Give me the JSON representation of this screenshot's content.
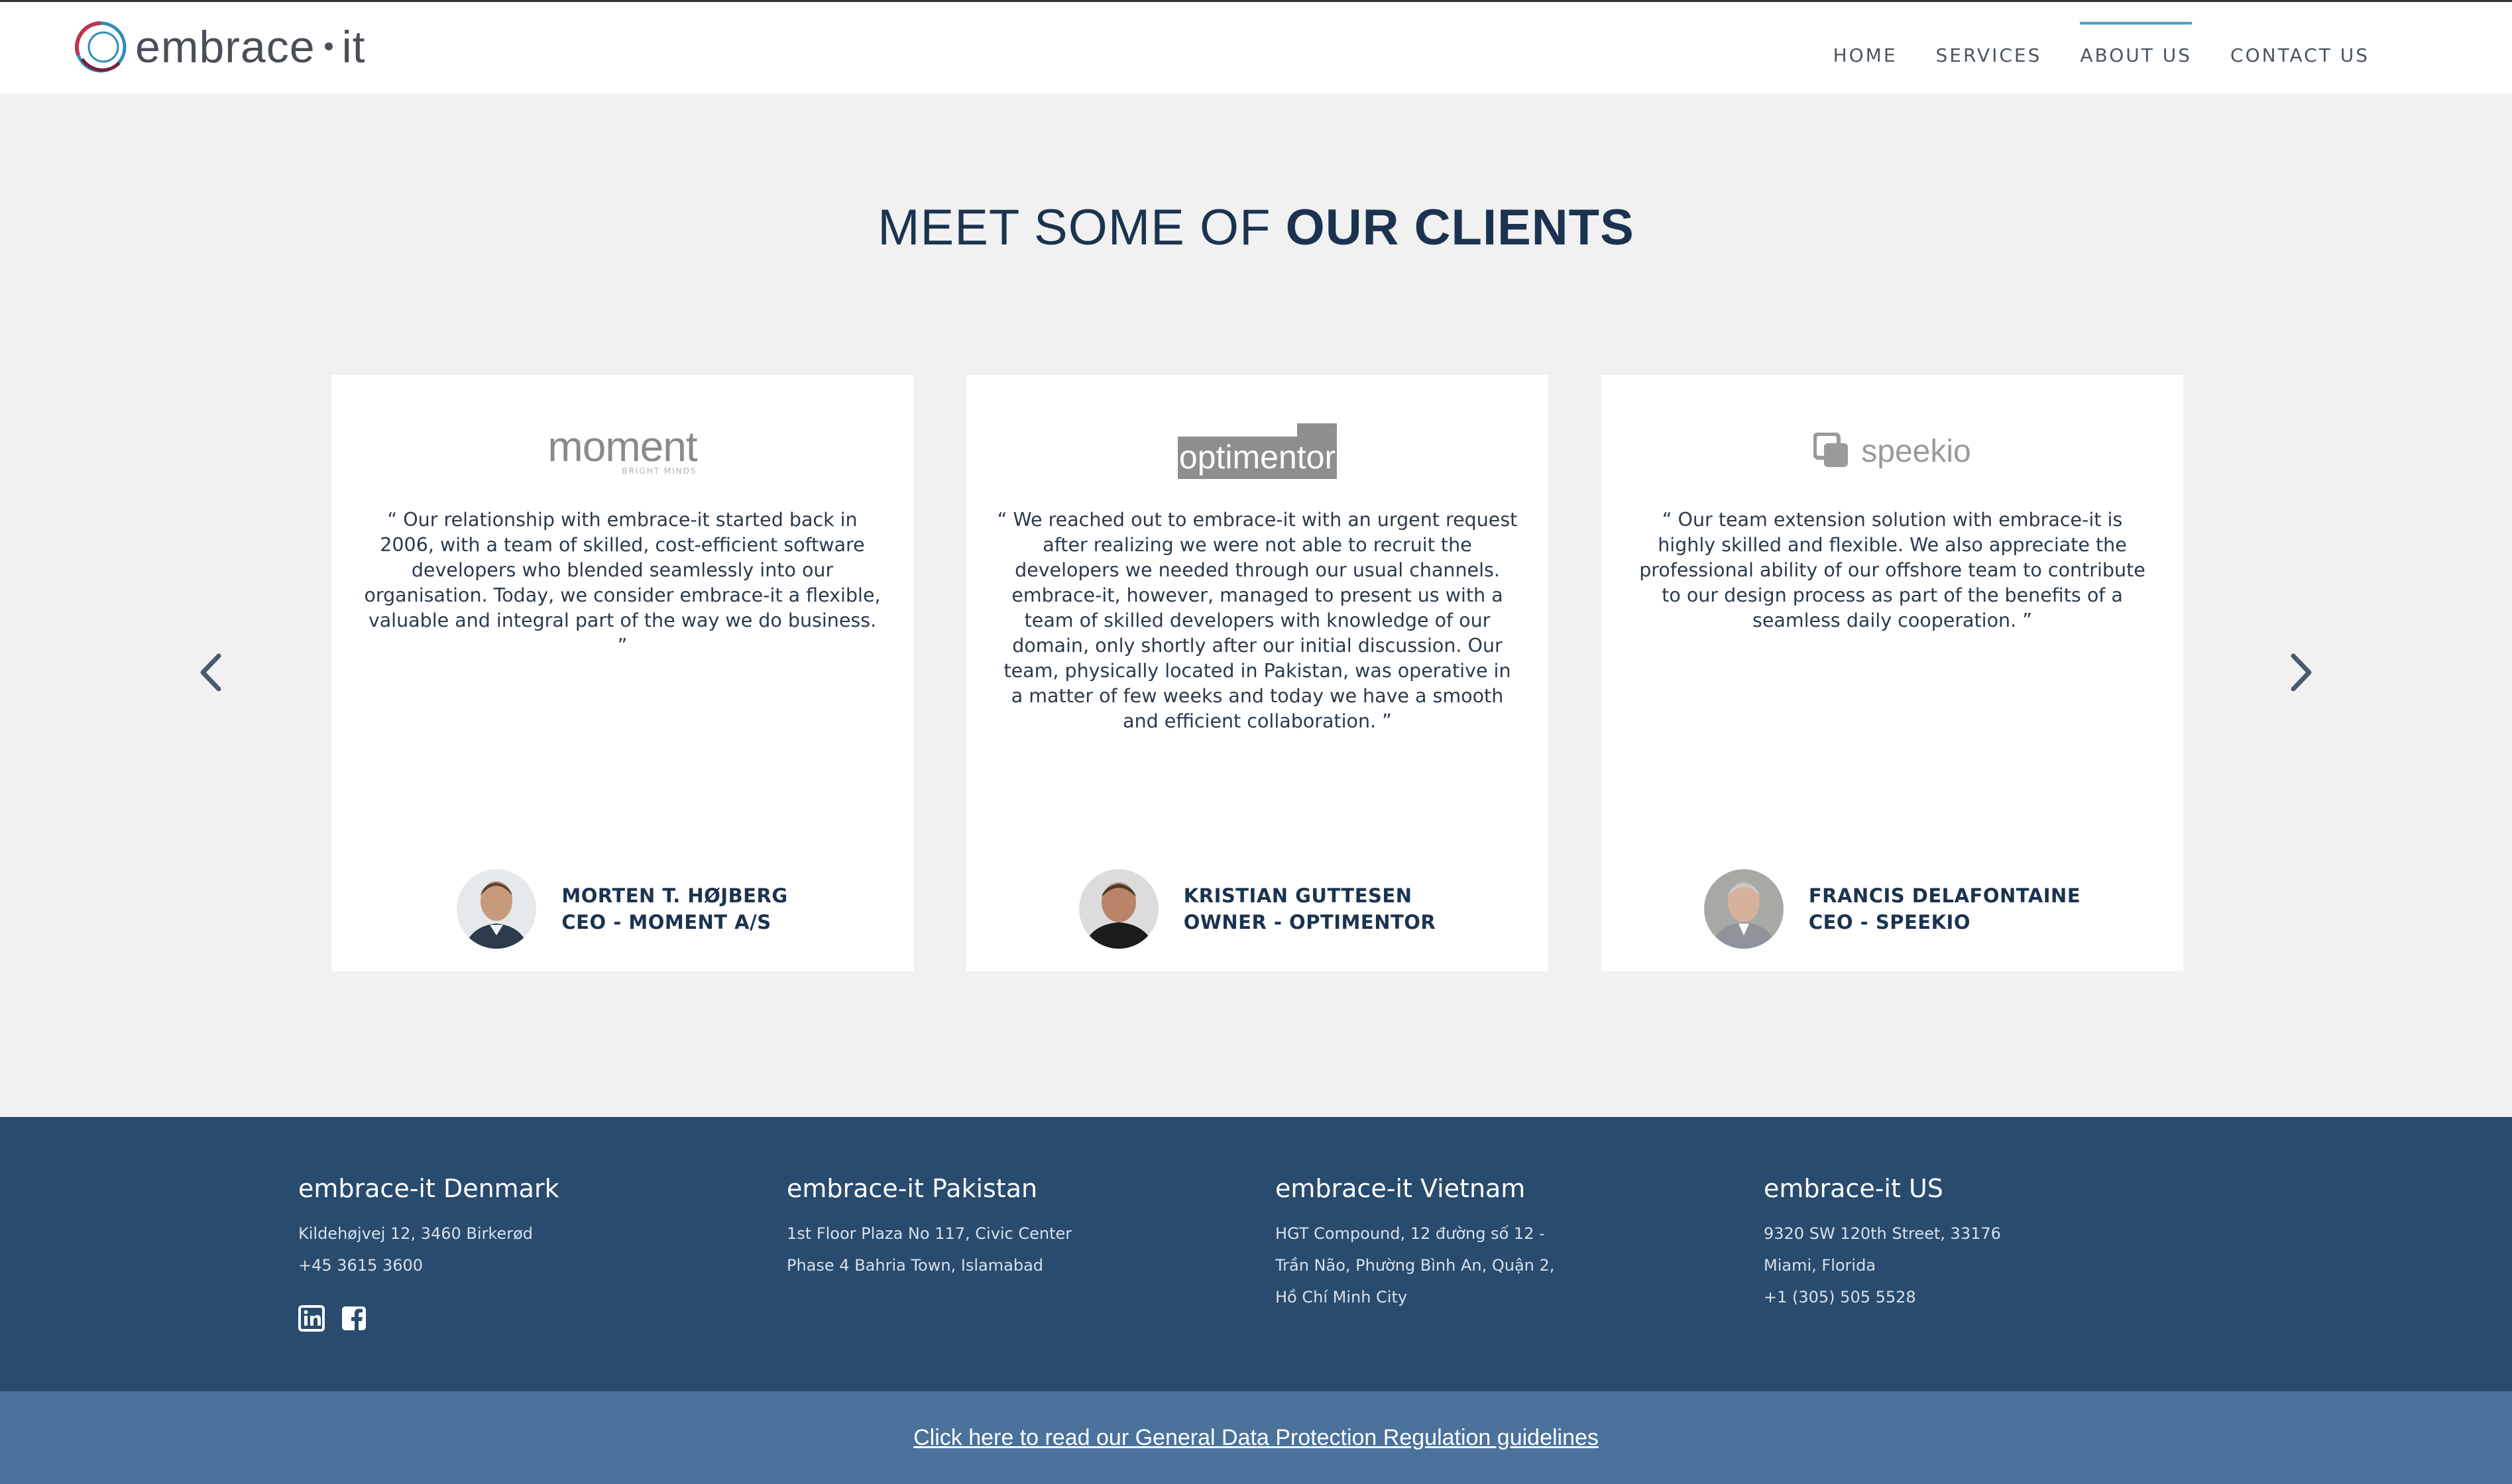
{
  "header": {
    "logo_text_left": "embrace",
    "logo_text_right": "it",
    "nav": [
      {
        "label": "HOME",
        "active": false
      },
      {
        "label": "SERVICES",
        "active": false
      },
      {
        "label": "ABOUT US",
        "active": true
      },
      {
        "label": "CONTACT US",
        "active": false
      }
    ]
  },
  "clients": {
    "title_light": "MEET SOME OF",
    "title_bold": "OUR CLIENTS",
    "prev_icon": "chevron-left-icon",
    "next_icon": "chevron-right-icon",
    "cards": [
      {
        "logo_text": "moment",
        "logo_subtext": "BRIGHT MINDS",
        "quote": "“ Our relationship with embrace-it started back in 2006, with a team of skilled, cost-efficient software developers who blended seamlessly into our organisation. Today, we consider embrace-it a flexible, valuable and integral part of the way we do business. ”",
        "name": "MORTEN T. HØJBERG",
        "role": "CEO - MOMENT A/S"
      },
      {
        "logo_text": "optimentor",
        "quote": "“ We reached out to embrace-it with an urgent request after realizing we were not able to recruit the developers we needed through our usual channels. embrace-it, however, managed to present us with a team of skilled developers with knowledge of our domain, only shortly after our initial discussion. Our team, physically located in Pakistan, was operative in a matter of few weeks and today we have a smooth and efficient collaboration. ”",
        "name": "KRISTIAN GUTTESEN",
        "role": "OWNER - OPTIMENTOR"
      },
      {
        "logo_text": "speekio",
        "quote": "“ Our team extension solution with embrace-it is highly skilled and flexible. We also appreciate the professional ability of our offshore team to contribute to our design process as part of the benefits of a seamless daily cooperation. ”",
        "name": "FRANCIS DELAFONTAINE",
        "role": "CEO - SPEEKIO"
      }
    ]
  },
  "footer": {
    "offices": [
      {
        "name": "embrace-it Denmark",
        "lines": [
          "Kildehøjvej 12, 3460 Birkerød",
          "+45 3615 3600"
        ]
      },
      {
        "name": "embrace-it Pakistan",
        "lines": [
          "1st Floor Plaza No 117, Civic Center",
          "Phase 4 Bahria Town, Islamabad"
        ]
      },
      {
        "name": "embrace-it Vietnam",
        "lines": [
          "HGT Compound, 12 đường số 12 -",
          "Trần Não, Phường Bình An, Quận 2,",
          "Hồ Chí Minh City"
        ]
      },
      {
        "name": "embrace-it US",
        "lines": [
          "9320 SW 120th Street, 33176",
          "Miami, Florida",
          "+1 (305) 505 5528"
        ]
      }
    ],
    "socials": [
      "linkedin-icon",
      "facebook-icon"
    ],
    "gdpr_link": "Click here to read our General Data Protection Regulation guidelines"
  },
  "colors": {
    "navy": "#1b3350",
    "footer_bg": "#284b6e",
    "gdpr_bg": "#4a729b",
    "accent": "#4aa3c8"
  }
}
